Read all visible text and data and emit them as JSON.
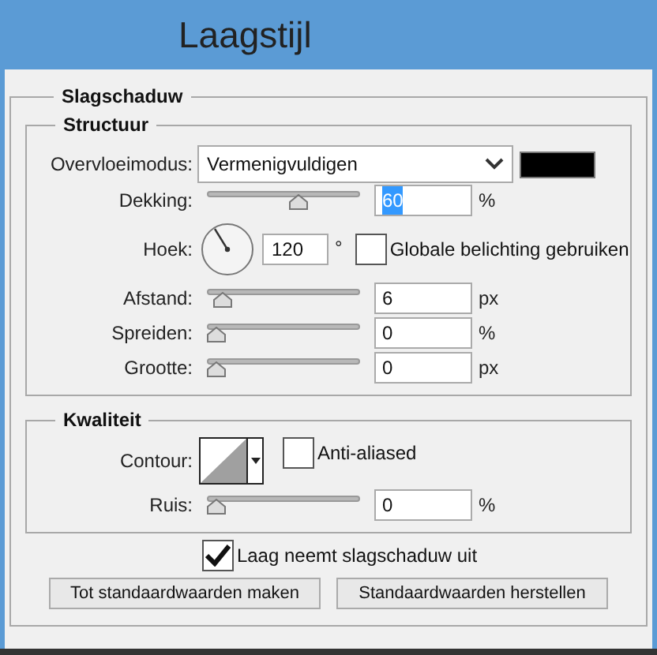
{
  "window": {
    "title": "Laagstijl"
  },
  "section": {
    "title": "Slagschaduw"
  },
  "structure": {
    "title": "Structuur",
    "blend_mode": {
      "label": "Overvloeimodus:",
      "value": "Vermenigvuldigen"
    },
    "rows": [
      {
        "kind": "slider",
        "label": "Dekking:",
        "level": 0.58,
        "value": "60",
        "unit": "%",
        "highlighted": true
      },
      {
        "kind": "angle",
        "label": "Hoek:",
        "value": "120",
        "unit": "°",
        "checkbox": {
          "label": "Globale belichting gebruiken",
          "checked": false
        }
      },
      {
        "kind": "slider",
        "label": "Afstand:",
        "level": 0.04,
        "value": "6",
        "unit": "px",
        "highlighted": false
      },
      {
        "kind": "slider",
        "label": "Spreiden:",
        "level": 0,
        "value": "0",
        "unit": "%",
        "highlighted": false
      },
      {
        "kind": "slider",
        "label": "Grootte:",
        "level": 0,
        "value": "0",
        "unit": "px",
        "highlighted": false
      }
    ]
  },
  "quality": {
    "title": "Kwaliteit",
    "contour": {
      "label": "Contour:"
    },
    "anti_aliased": {
      "label": "Anti-aliased",
      "checked": false
    },
    "rows": [
      {
        "kind": "slider",
        "label": "Ruis:",
        "level": 0,
        "value": "0",
        "unit": "%",
        "highlighted": false
      }
    ]
  },
  "layer_knocks_out": {
    "label": "Laag neemt slagschaduw uit",
    "checked": true
  },
  "buttons": [
    "Tot standaardwaarden maken",
    "Standaardwaarden herstellen"
  ]
}
